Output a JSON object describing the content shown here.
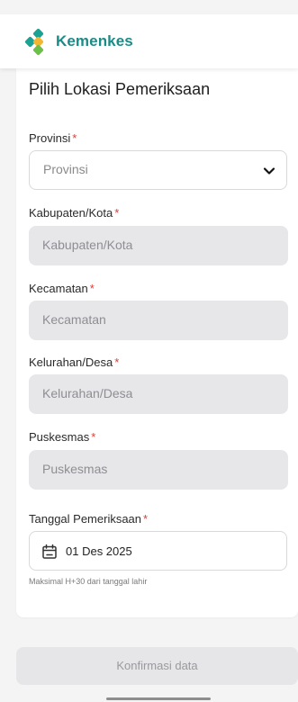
{
  "header": {
    "brand_name": "Kemenkes",
    "logo_icon": "kemenkes-logo-icon",
    "logo_colors": [
      "#1aa394",
      "#f2b630",
      "#1aa394"
    ]
  },
  "page": {
    "title": "Pilih Lokasi Pemeriksaan"
  },
  "form": {
    "required_mark": "*",
    "provinsi": {
      "label": "Provinsi",
      "value": "Provinsi",
      "icon": "chevron-down-icon"
    },
    "kabupaten": {
      "label": "Kabupaten/Kota",
      "placeholder": "Kabupaten/Kota"
    },
    "kecamatan": {
      "label": "Kecamatan",
      "placeholder": "Kecamatan"
    },
    "kelurahan": {
      "label": "Kelurahan/Desa",
      "placeholder": "Kelurahan/Desa"
    },
    "puskesmas": {
      "label": "Puskesmas",
      "placeholder": "Puskesmas"
    },
    "tanggal": {
      "label": "Tanggal Pemeriksaan",
      "value": "01 Des 2025",
      "icon": "calendar-icon",
      "helper": "Maksimal H+30 dari tanggal lahir"
    }
  },
  "actions": {
    "confirm_label": "Konfirmasi data"
  },
  "colors": {
    "brand": "#1a8c86",
    "required": "#e53935",
    "disabled_bg": "#e7e7ea"
  }
}
